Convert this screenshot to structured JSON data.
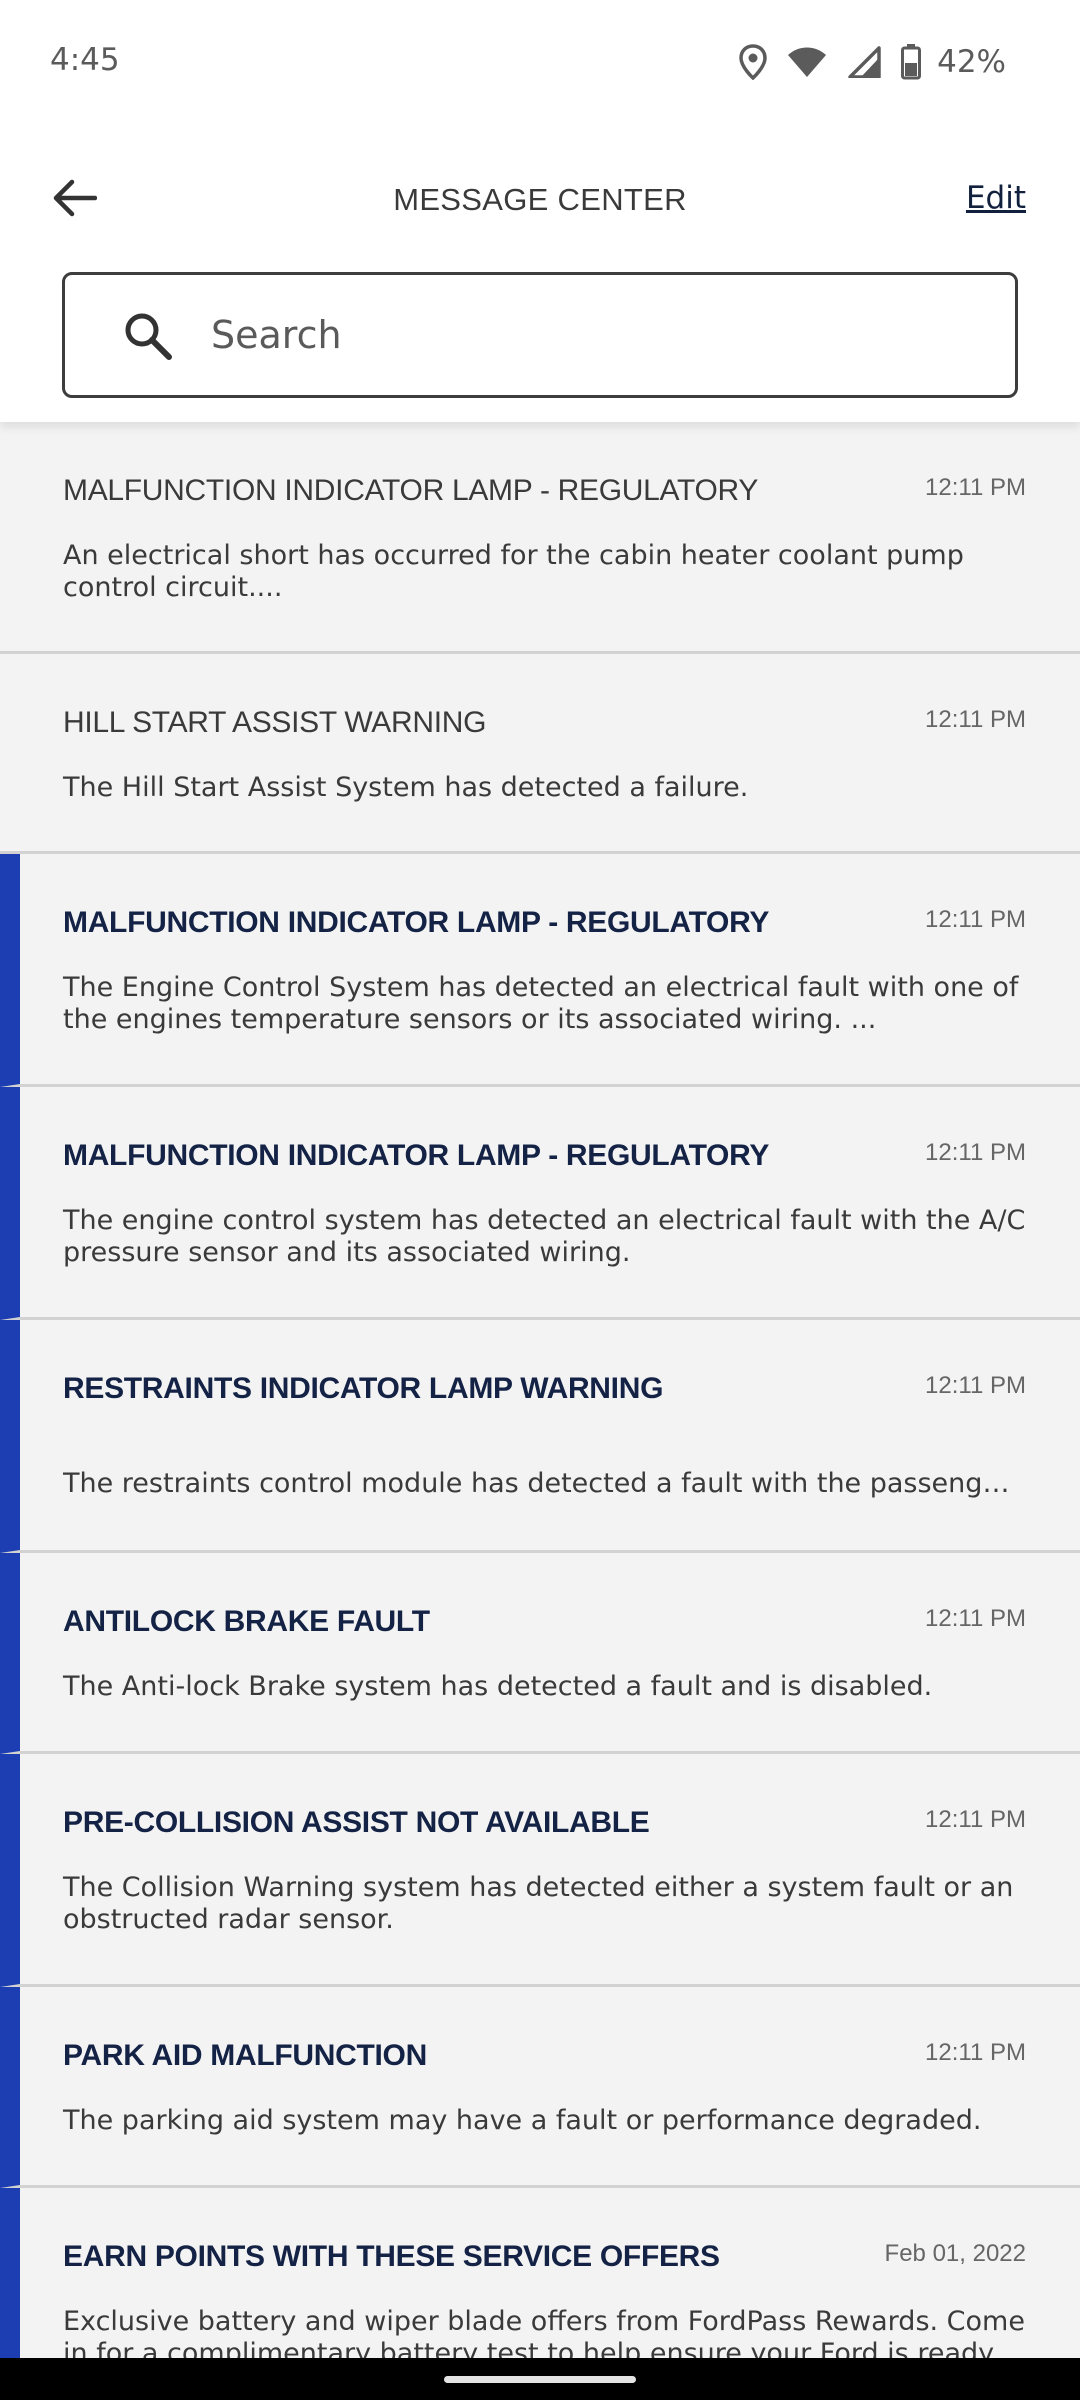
{
  "status_bar": {
    "time": "4:45",
    "battery": "42%",
    "icons": [
      "location-icon",
      "wifi-icon",
      "cell-signal-icon",
      "battery-icon"
    ]
  },
  "header": {
    "title": "MESSAGE CENTER",
    "edit_label": "Edit",
    "back_icon": "back-arrow-icon"
  },
  "search": {
    "placeholder": "Search",
    "value": ""
  },
  "colors": {
    "unread_accent": "#1d3db3",
    "title_unread": "#132245"
  },
  "messages": [
    {
      "title": "MALFUNCTION INDICATOR LAMP - REGULATORY",
      "time": "12:11 PM",
      "body": "An electrical short has occurred for the cabin heater coolant pump control circuit....",
      "unread": false
    },
    {
      "title": "HILL START ASSIST WARNING",
      "time": "12:11 PM",
      "body": "The Hill Start Assist System has detected a failure.",
      "unread": false
    },
    {
      "title": "MALFUNCTION INDICATOR LAMP - REGULATORY",
      "time": "12:11 PM",
      "body": "The Engine Control System has detected an electrical fault with one of the engines temperature sensors or its associated wiring. ...",
      "unread": true
    },
    {
      "title": "MALFUNCTION INDICATOR LAMP - REGULATORY",
      "time": "12:11 PM",
      "body": "The engine control system has detected an electrical fault with the A/C pressure sensor and its associated wiring.",
      "unread": true
    },
    {
      "title": "RESTRAINTS INDICATOR LAMP WARNING",
      "time": "12:11 PM",
      "body": "The restraints control module has detected a fault with the passenger f...",
      "unread": true
    },
    {
      "title": "ANTILOCK BRAKE FAULT",
      "time": "12:11 PM",
      "body": "The Anti-lock Brake system has detected a fault and is disabled.",
      "unread": true
    },
    {
      "title": "PRE-COLLISION ASSIST NOT AVAILABLE",
      "time": "12:11 PM",
      "body": "The Collision Warning system has detected either a system fault or an obstructed radar sensor.",
      "unread": true
    },
    {
      "title": "PARK AID MALFUNCTION",
      "time": "12:11 PM",
      "body": "The parking aid system may have a fault or performance degraded.",
      "unread": true
    },
    {
      "title": "EARN POINTS WITH THESE SERVICE OFFERS",
      "time": "Feb 01, 2022",
      "body": " Exclusive battery and wiper blade offers from FordPass Rewards. Come in for a complimentary battery test to help ensure your Ford is ready to",
      "unread": true
    }
  ]
}
